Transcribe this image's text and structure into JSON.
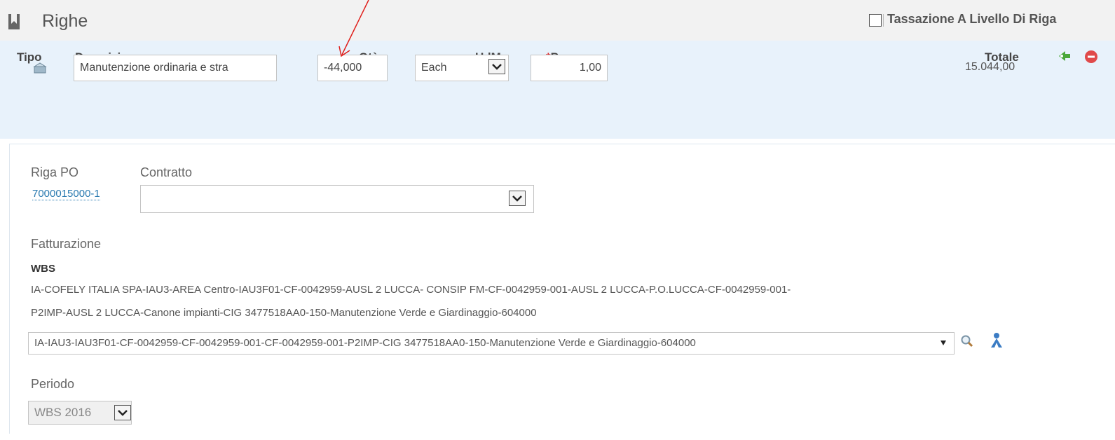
{
  "header": {
    "title": "Righe",
    "tax_label": "Tassazione A Livello Di Riga",
    "tax_checked": false
  },
  "columns": {
    "tipo": "Tipo",
    "descrizione": "Descrizione",
    "qta": "Qtà",
    "udm": "UdM",
    "prezzo_required": "*",
    "prezzo": "Prezzo",
    "totale": "Totale"
  },
  "line": {
    "descrizione": "Manutenzione ordinaria e stra",
    "qta": "-44,000",
    "udm": "Each",
    "prezzo": "1,00",
    "totale": "15.044,00"
  },
  "detail": {
    "riga_po_label": "Riga PO",
    "riga_po_value": "7000015000-1",
    "contratto_label": "Contratto",
    "contratto_value": "",
    "fatturazione_label": "Fatturazione",
    "wbs_label": "WBS",
    "wbs_text_line1": "IA-COFELY ITALIA SPA-IAU3-AREA Centro-IAU3F01-CF-0042959-AUSL 2 LUCCA- CONSIP FM-CF-0042959-001-AUSL 2 LUCCA-P.O.LUCCA-CF-0042959-001-",
    "wbs_text_line2": "P2IMP-AUSL 2 LUCCA-Canone impianti-CIG 3477518AA0-150-Manutenzione Verde e Giardinaggio-604000",
    "wbs_select_value": "IA-IAU3-IAU3F01-CF-0042959-CF-0042959-001-CF-0042959-001-P2IMP-CIG 3477518AA0-150-Manutenzione Verde e Giardinaggio-604000",
    "periodo_label": "Periodo",
    "periodo_value": "WBS 2016"
  },
  "colors": {
    "header_bg": "#f2f2f2",
    "band_bg": "#e8f2fb",
    "link": "#2a7ab0",
    "annotation_arrow": "#e0201c",
    "add_icon": "#4aa83a",
    "remove_icon": "#e04a4a"
  },
  "icons": {
    "header": "bookmark-icon",
    "tipo": "catalog-item-icon",
    "add": "split-line-icon",
    "remove": "delete-line-icon",
    "search": "magnifier-icon",
    "tree": "hierarchy-icon"
  }
}
